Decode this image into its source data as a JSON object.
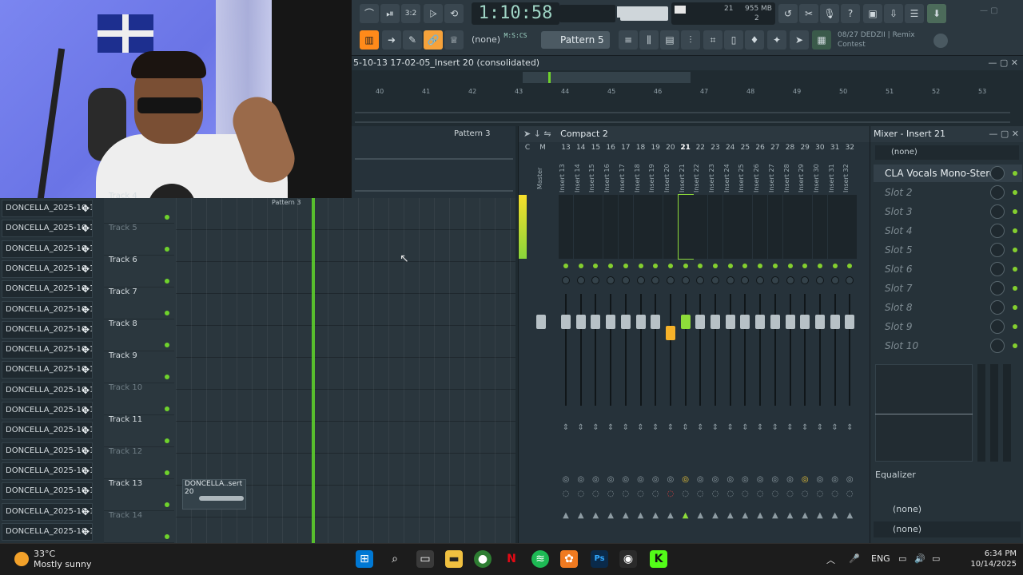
{
  "toolbar": {
    "time": "1:10:58",
    "time_unit": "M:S:CS",
    "cpu_mem": "955 MB",
    "cpu_voices": "21",
    "cpu_poly": "2",
    "pattern_selector": "Pattern 5",
    "none_selector": "(none)",
    "hint_line1": "08/27  DEDZII | Remix",
    "hint_line2": "Contest"
  },
  "playlist": {
    "title": "5-10-13 17-02-05_Insert 20 (consolidated)",
    "ruler": [
      "40",
      "41",
      "42",
      "43",
      "44",
      "45",
      "46",
      "47",
      "48",
      "49",
      "50",
      "51",
      "52",
      "53"
    ],
    "pattern3_label": "Pattern 3",
    "pattern_bar_label": "Pattern 3",
    "tracks": [
      {
        "name": "Track 4",
        "dim": false
      },
      {
        "name": "Track 5",
        "dim": true
      },
      {
        "name": "Track 6",
        "dim": false
      },
      {
        "name": "Track 7",
        "dim": false
      },
      {
        "name": "Track 8",
        "dim": false
      },
      {
        "name": "Track 9",
        "dim": false
      },
      {
        "name": "Track 10",
        "dim": true
      },
      {
        "name": "Track 11",
        "dim": false
      },
      {
        "name": "Track 12",
        "dim": true
      },
      {
        "name": "Track 13",
        "dim": false
      },
      {
        "name": "Track 14",
        "dim": true
      }
    ],
    "clip13_label": "DONCELLA..sert 20"
  },
  "channels": {
    "label": "DONCELLA_2025-10-1...",
    "count": 17
  },
  "mixer": {
    "title": "Compact 2",
    "master_label": "Master",
    "columns": [
      "C",
      "M",
      "13",
      "14",
      "15",
      "16",
      "17",
      "18",
      "19",
      "20",
      "21",
      "22",
      "23",
      "24",
      "25",
      "26",
      "27",
      "28",
      "29",
      "30",
      "31",
      "32"
    ],
    "inserts": [
      "Insert 13",
      "Insert 14",
      "Insert 15",
      "Insert 16",
      "Insert 17",
      "Insert 18",
      "Insert 19",
      "Insert 20",
      "Insert 21",
      "Insert 22",
      "Insert 23",
      "Insert 24",
      "Insert 25",
      "Insert 26",
      "Insert 27",
      "Insert 28",
      "Insert 29",
      "Insert 30",
      "Insert 31",
      "Insert 32"
    ],
    "selected": "21"
  },
  "insert_panel": {
    "title": "Mixer - Insert 21",
    "preset": "(none)",
    "slots": [
      "CLA Vocals Mono-Stereo",
      "Slot 2",
      "Slot 3",
      "Slot 4",
      "Slot 5",
      "Slot 6",
      "Slot 7",
      "Slot 8",
      "Slot 9",
      "Slot 10"
    ],
    "eq_label": "Equalizer",
    "route_in": "(none)",
    "route_out": "(none)"
  },
  "taskbar": {
    "temp": "33°C",
    "weather": "Mostly sunny",
    "lang": "ENG",
    "time": "6:34 PM",
    "date": "10/14/2025"
  },
  "colors": {
    "accent": "#8edc3a",
    "orange": "#ff8a1a",
    "bg": "#26323a"
  }
}
